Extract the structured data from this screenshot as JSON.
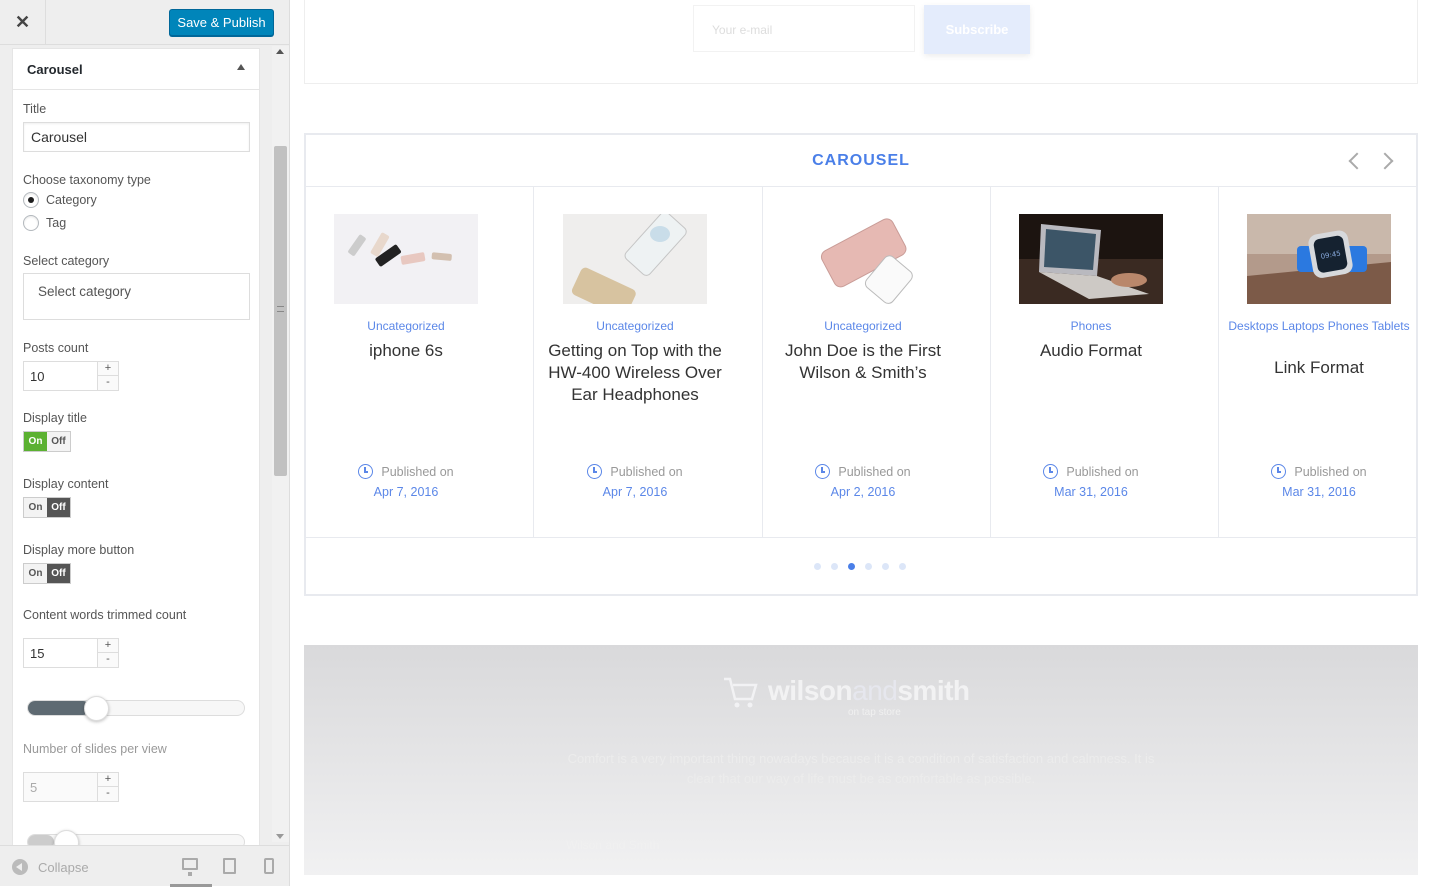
{
  "header": {
    "close_label": "✕",
    "save_label": "Save & Publish"
  },
  "widget": {
    "title": "Carousel",
    "fields": {
      "title_label": "Title",
      "title_value": "Carousel",
      "taxonomy_label": "Choose taxonomy type",
      "taxonomy_options": [
        "Category",
        "Tag"
      ],
      "taxonomy_selected": "Category",
      "category_label": "Select category",
      "category_placeholder": "Select category",
      "posts_count_label": "Posts count",
      "posts_count_value": "10",
      "display_title_label": "Display title",
      "display_title_state": "on",
      "display_content_label": "Display content",
      "display_content_state": "off",
      "display_more_label": "Display more button",
      "display_more_state": "off",
      "trim_label": "Content words trimmed count",
      "trim_value": "15",
      "trim_slider_fraction": 0.25,
      "slides_label": "Number of slides per view",
      "slides_value": "5",
      "toggle_on": "On",
      "toggle_off": "Off",
      "plus": "+",
      "minus": "-"
    }
  },
  "footer_bar": {
    "collapse_label": "Collapse",
    "devices": [
      "desktop-icon",
      "tablet-icon",
      "mobile-icon"
    ]
  },
  "preview": {
    "subscribe": {
      "email_placeholder": "Your e-mail",
      "button_label": "Subscribe"
    },
    "carousel": {
      "title": "CAROUSEL",
      "published_label": "Published on",
      "cards": [
        {
          "category": "Uncategorized",
          "title": "iphone 6s",
          "date": "Apr 7, 2016"
        },
        {
          "category": "Uncategorized",
          "title": "Getting on Top with the HW-400 Wireless Over Ear Headphones",
          "date": "Apr 7, 2016"
        },
        {
          "category": "Uncategorized",
          "title": "John Doe is the First Wilson & Smith’s",
          "date": "Apr 2, 2016"
        },
        {
          "category": "Phones",
          "title": "Audio Format",
          "date": "Mar 31, 2016"
        },
        {
          "category": "Desktops Laptops Phones Tablets",
          "title": "Link Format",
          "date": "Mar 31, 2016"
        }
      ],
      "dots_count": 6,
      "active_dot": 3
    },
    "site_footer": {
      "brand_first": "wilson",
      "brand_mid": "and",
      "brand_last": "smith",
      "tagline": "on tap store",
      "description": "Comfort is a very important thing nowadays because it is a condition of satisfaction and calmness. It is clear that our way of life must be as comfortable as possible.",
      "copyright": "Wilson and Smith"
    }
  }
}
